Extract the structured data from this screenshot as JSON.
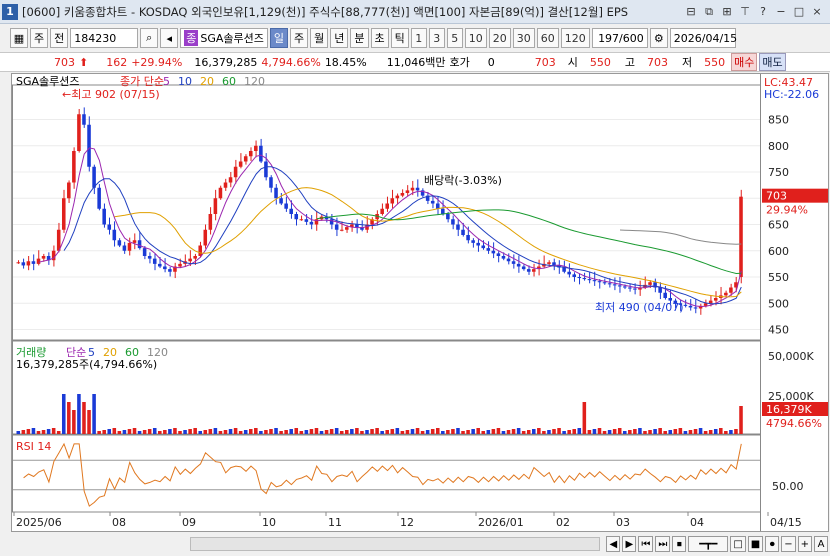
{
  "window": {
    "title": "[0600] 키움종합차트 - KOSDAQ 외국인보유[1,129(천)] 주식수[88,777(천)] 액면[100] 자본금[89(억)] 결산[12월] EPS",
    "app_icon": "1",
    "btns": [
      "⊟",
      "⧉",
      "⊞",
      "⊤",
      "?",
      "−",
      "□",
      "×"
    ]
  },
  "toolbar": {
    "type1": "주",
    "type2": "전",
    "code": "184230",
    "name": "SGA솔루션즈",
    "period_on": "일",
    "periods": [
      "주",
      "월",
      "년",
      "분",
      "초",
      "틱"
    ],
    "nums": [
      "1",
      "3",
      "5",
      "10",
      "20",
      "30",
      "60",
      "120"
    ],
    "count": "197/600",
    "date": "2026/04/15"
  },
  "pricebar": {
    "price": "703",
    "change": "162",
    "change_pct": "+29.94%",
    "volume": "16,379,285",
    "vol_pct": "4,794.66%",
    "turnover": "18.45%",
    "amount": "11,046백만",
    "quote_label": "호가",
    "quote_val": "0",
    "p1": "703",
    "open_l": "시",
    "open": "550",
    "high_l": "고",
    "high": "703",
    "low_l": "저",
    "low": "550",
    "buy": "매수",
    "sell": "매도"
  },
  "chart_data": [
    {
      "type": "candlestick",
      "title": "SGA솔루션즈",
      "legend": [
        "종가 단순",
        "5",
        "10",
        "20",
        "60",
        "120"
      ],
      "annotations": {
        "high": "←최고 902 (07/15)",
        "low": "최저 490 (04/07)",
        "div": "배당락(-3.03%)",
        "lc": "LC:43.47",
        "hc": "HC:-22.06",
        "last": "703",
        "last_pct": "29.94%"
      },
      "ylim": [
        430,
        910
      ],
      "yticks": [
        450,
        500,
        550,
        600,
        650,
        700,
        750,
        800,
        850
      ],
      "xlabels": [
        "2025/06",
        "08",
        "09",
        "10",
        "11",
        "12",
        "2026/01",
        "02",
        "03",
        "04",
        "04/15"
      ],
      "close": [
        578,
        572,
        580,
        575,
        585,
        590,
        582,
        600,
        640,
        700,
        730,
        790,
        860,
        840,
        760,
        720,
        680,
        650,
        640,
        620,
        610,
        600,
        615,
        620,
        605,
        590,
        585,
        575,
        570,
        565,
        560,
        570,
        575,
        580,
        585,
        590,
        610,
        640,
        670,
        700,
        720,
        730,
        740,
        760,
        770,
        780,
        790,
        800,
        770,
        740,
        720,
        700,
        690,
        680,
        670,
        660,
        660,
        655,
        650,
        660,
        665,
        660,
        650,
        640,
        640,
        645,
        650,
        645,
        640,
        650,
        660,
        670,
        680,
        690,
        700,
        705,
        710,
        715,
        720,
        715,
        705,
        695,
        690,
        680,
        670,
        660,
        650,
        640,
        630,
        620,
        615,
        610,
        605,
        600,
        595,
        590,
        585,
        580,
        575,
        570,
        565,
        560,
        565,
        570,
        575,
        578,
        572,
        568,
        560,
        555,
        550,
        548,
        546,
        544,
        542,
        540,
        538,
        536,
        534,
        532,
        530,
        528,
        526,
        530,
        535,
        540,
        530,
        520,
        510,
        505,
        500,
        497,
        495,
        492,
        490,
        495,
        500,
        505,
        510,
        515,
        520,
        530,
        540,
        703
      ]
    },
    {
      "type": "bar",
      "title": "거래량",
      "legend": [
        "단순",
        "5",
        "20",
        "60",
        "120"
      ],
      "vol_text": "16,379,285주(4,794.66%)",
      "yticks": [
        "50,000K",
        "25,000K"
      ],
      "last": "16,379K",
      "last_pct": "4794.66%"
    },
    {
      "type": "line",
      "title": "RSI 14",
      "ytick": "50.00"
    }
  ],
  "bottom": {
    "btns": [
      "◀",
      "▶",
      "⏮",
      "⏭",
      "⏹",
      "□",
      "■",
      "⏺",
      "−",
      "+",
      "A"
    ]
  }
}
